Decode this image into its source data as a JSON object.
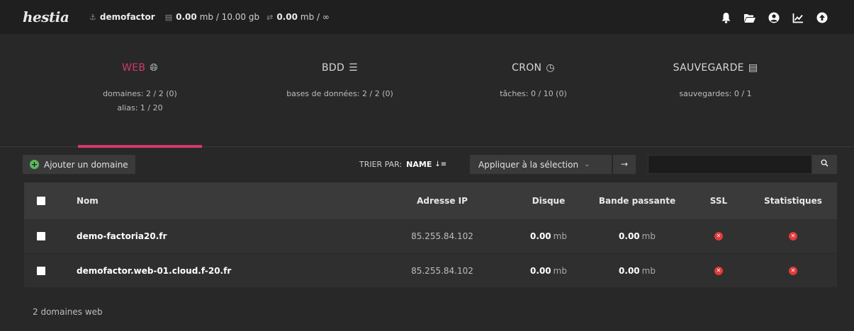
{
  "topbar": {
    "logo": "hestia",
    "user": "demofactor",
    "disk_used": "0.00",
    "disk_used_unit": "mb / 10.00 gb",
    "bw_used": "0.00",
    "bw_used_unit": "mb / ∞"
  },
  "tabs": [
    {
      "label": "WEB",
      "icon": "globe-icon",
      "stat1": "domaines: 2 / 2 (0)",
      "stat2": "alias: 1 / 20",
      "active": true
    },
    {
      "label": "BDD",
      "icon": "database-icon",
      "stat1": "bases de données: 2 / 2 (0)",
      "stat2": "",
      "active": false
    },
    {
      "label": "CRON",
      "icon": "clock-icon",
      "stat1": "tâches: 0 / 10 (0)",
      "stat2": "",
      "active": false
    },
    {
      "label": "SAUVEGARDE",
      "icon": "file-icon",
      "stat1": "sauvegardes: 0 / 1",
      "stat2": "",
      "active": false
    }
  ],
  "toolbar": {
    "add_label": "Ajouter un domaine",
    "sort_label": "TRIER PAR:",
    "sort_value": "NAME",
    "bulk_label": "Appliquer à la sélection",
    "go_arrow": "→",
    "search_placeholder": ""
  },
  "table": {
    "headers": {
      "name": "Nom",
      "ip": "Adresse IP",
      "disk": "Disque",
      "bw": "Bande passante",
      "ssl": "SSL",
      "stats": "Statistiques"
    },
    "rows": [
      {
        "name": "demo-factoria20.fr",
        "ip": "85.255.84.102",
        "disk": "0.00",
        "disk_unit": "mb",
        "bw": "0.00",
        "bw_unit": "mb"
      },
      {
        "name": "demofactor.web-01.cloud.f-20.fr",
        "ip": "85.255.84.102",
        "disk": "0.00",
        "disk_unit": "mb",
        "bw": "0.00",
        "bw_unit": "mb"
      }
    ]
  },
  "footer": "2 domaines web",
  "colors": {
    "accent": "#d4386f",
    "danger": "#e33a3a",
    "success": "#5cb85c"
  }
}
